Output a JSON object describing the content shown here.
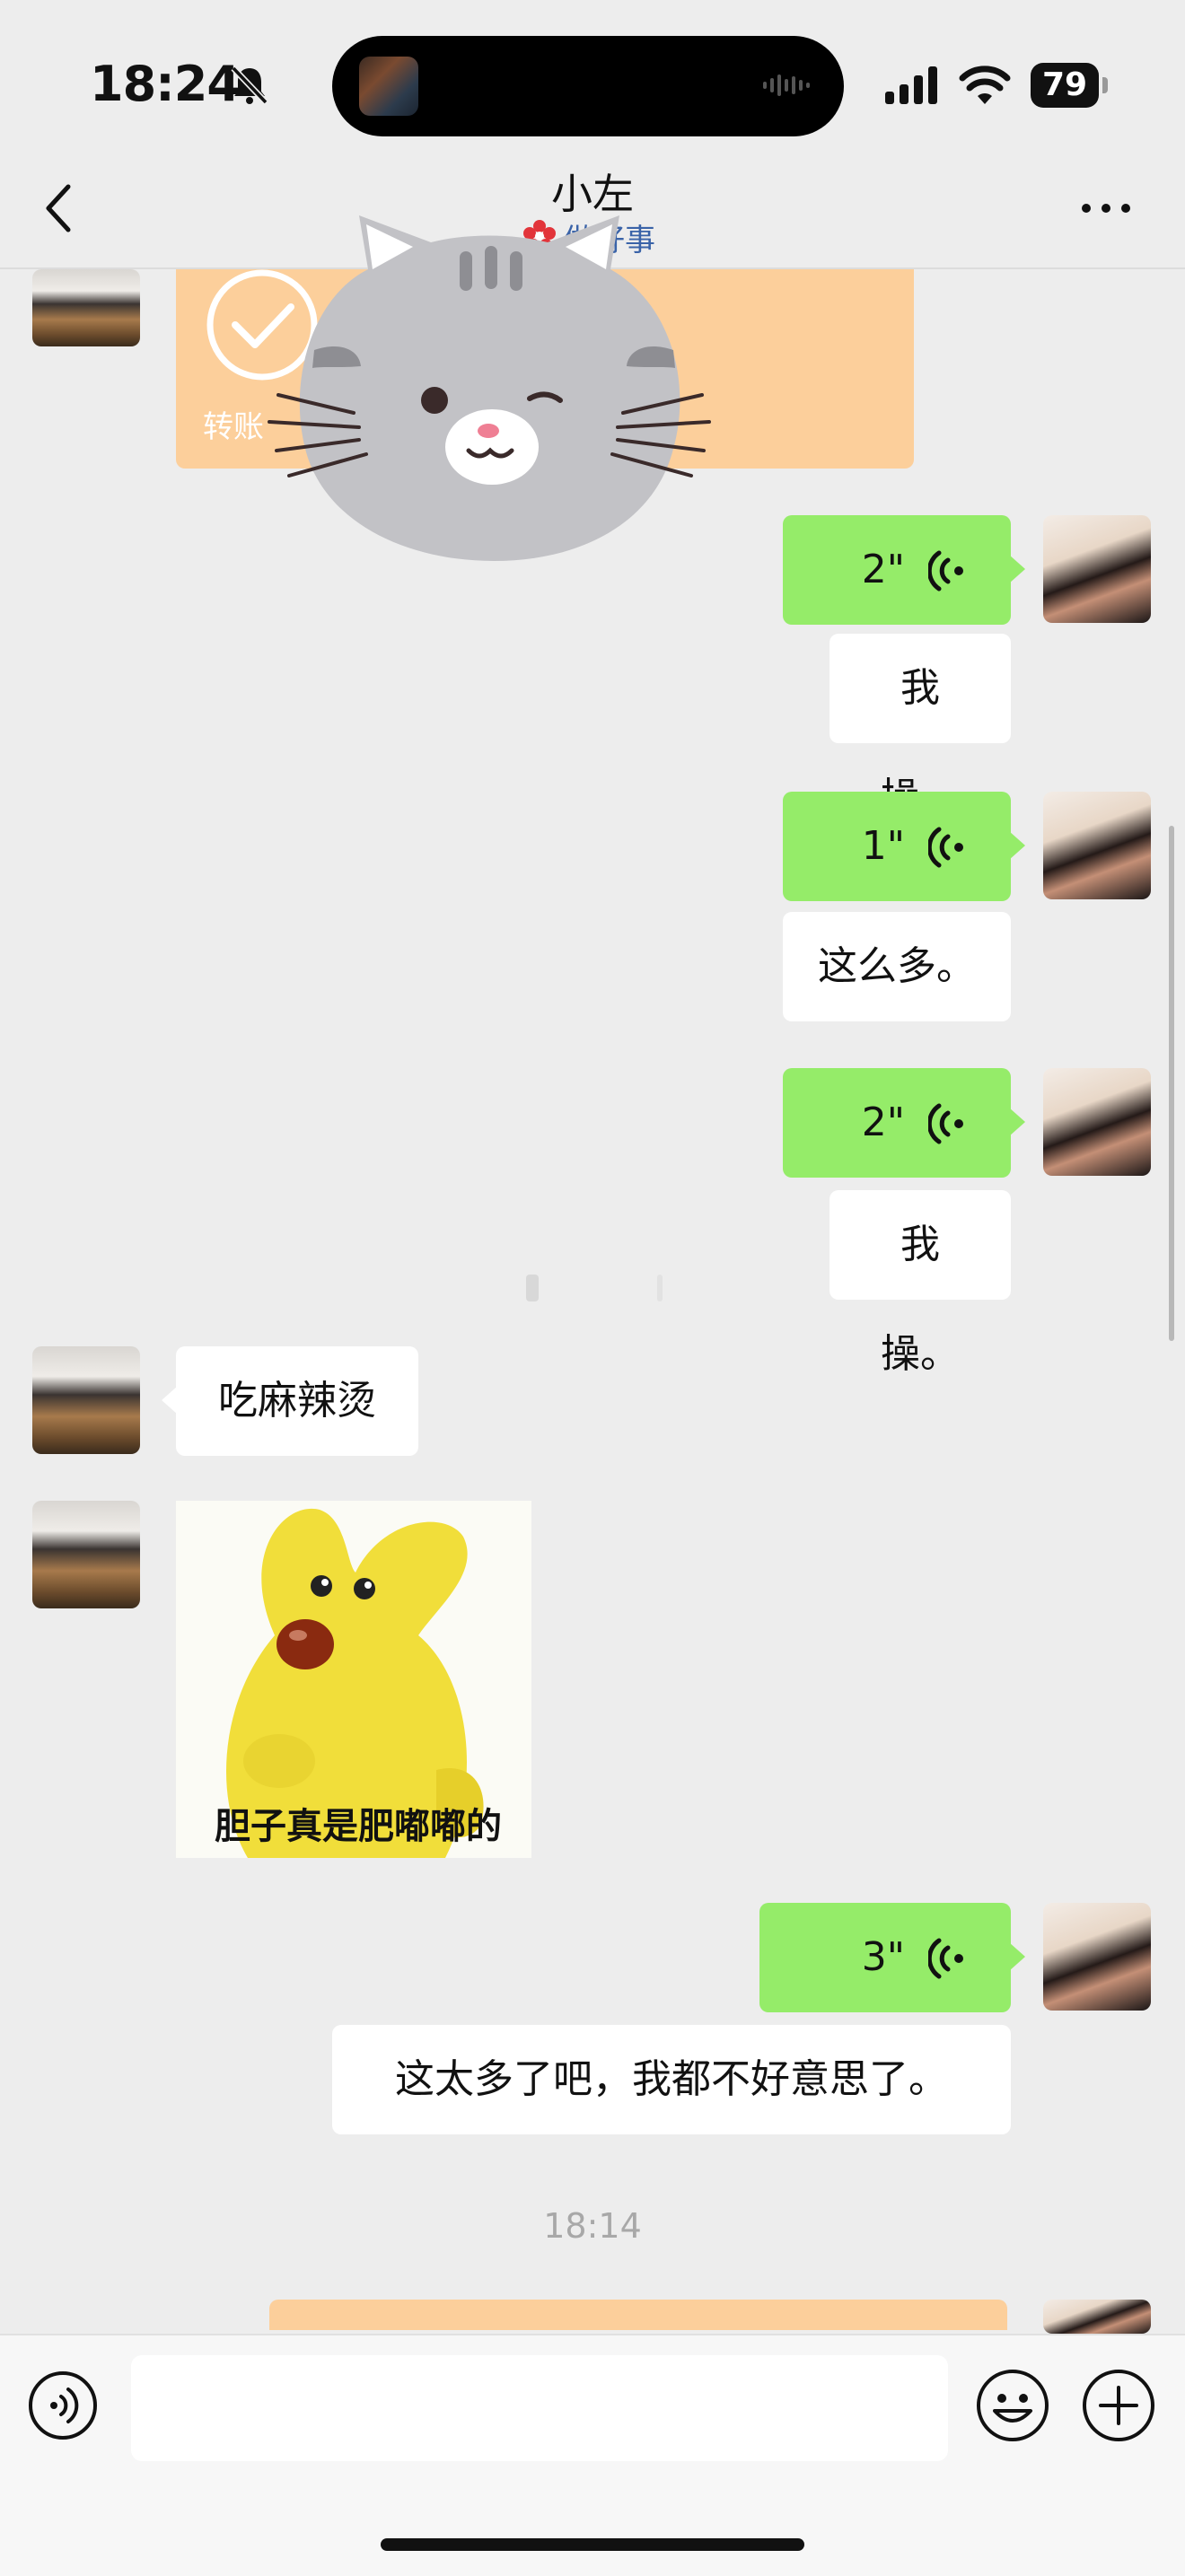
{
  "status_bar": {
    "time": "18:24",
    "battery": "79",
    "icons": [
      "bell-muted-icon",
      "signal-icon",
      "wifi-icon",
      "battery-icon"
    ]
  },
  "nav": {
    "title": "小左",
    "subtitle": "做好事",
    "back_icon": "chevron-left-icon",
    "more_icon": "more-dots-icon"
  },
  "messages": {
    "transfer_label": "转账",
    "m1_voice": "2\"",
    "m1_text": "我操。",
    "m2_voice": "1\"",
    "m2_text": "这么多。",
    "m3_voice": "2\"",
    "m3_text": "我操。",
    "m4_text": "吃麻辣烫",
    "m5_sticker_caption": "胆子真是肥嘟嘟的",
    "m6_voice": "3\"",
    "m6_text": "这太多了吧，我都不好意思了。",
    "timestamp": "18:14"
  },
  "colors": {
    "chat_bg": "#ededed",
    "sent_bubble": "#95ec69",
    "received_bubble": "#ffffff",
    "transfer_card": "#fccf9b"
  },
  "input_bar": {
    "value": "",
    "left_icon": "voice-toggle-icon",
    "right_icons": [
      "emoji-icon",
      "plus-icon"
    ]
  }
}
